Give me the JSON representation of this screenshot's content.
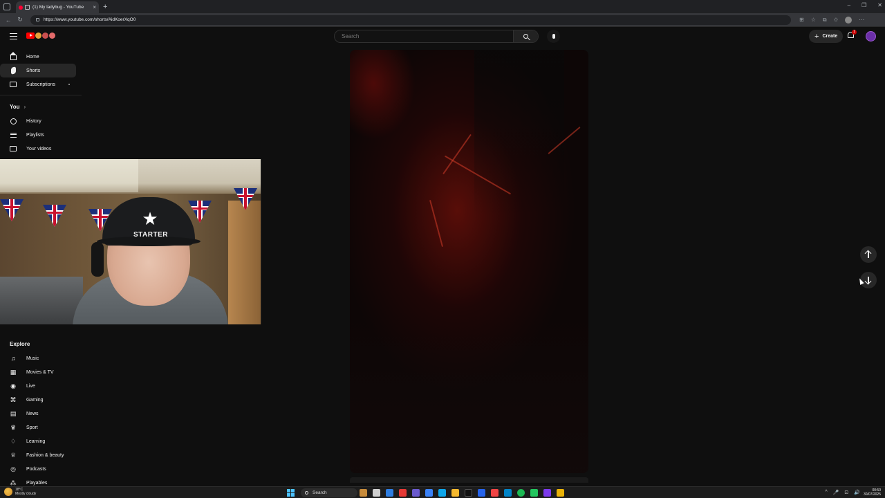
{
  "browser": {
    "tab_title": "(1) My ladybug - YouTube",
    "url": "https://www.youtube.com/shorts/AidKoerXqO0",
    "new_tab_glyph": "+",
    "close_glyph": "×",
    "window_controls": [
      "–",
      "❐",
      "✕"
    ]
  },
  "header": {
    "search_placeholder": "Search",
    "create_label": "Create",
    "create_glyph": "+",
    "notification_count": "1"
  },
  "sidebar": {
    "top_items": [
      {
        "label": "Home",
        "icon": "home-icon"
      },
      {
        "label": "Shorts",
        "icon": "shorts-icon",
        "active": true
      },
      {
        "label": "Subscriptions",
        "icon": "subscriptions-icon"
      }
    ],
    "you_section": {
      "title": "You",
      "chevron": "›",
      "items": [
        {
          "label": "History",
          "icon": "history-icon"
        },
        {
          "label": "Playlists",
          "icon": "playlists-icon"
        },
        {
          "label": "Your videos",
          "icon": "your-videos-icon"
        }
      ]
    },
    "explore_section": {
      "title": "Explore",
      "items": [
        {
          "label": "Music",
          "icon": "music-icon",
          "glyph": "♫"
        },
        {
          "label": "Movies & TV",
          "icon": "movies-icon",
          "glyph": "▦"
        },
        {
          "label": "Live",
          "icon": "live-icon",
          "glyph": "◉"
        },
        {
          "label": "Gaming",
          "icon": "gaming-icon",
          "glyph": "⌘"
        },
        {
          "label": "News",
          "icon": "news-icon",
          "glyph": "▤"
        },
        {
          "label": "Sport",
          "icon": "sport-icon",
          "glyph": "♛"
        },
        {
          "label": "Learning",
          "icon": "learning-icon",
          "glyph": "♢"
        },
        {
          "label": "Fashion & beauty",
          "icon": "fashion-icon",
          "glyph": "♕"
        },
        {
          "label": "Podcasts",
          "icon": "podcasts-icon",
          "glyph": "◎"
        },
        {
          "label": "Playables",
          "icon": "playables-icon",
          "glyph": "⁂"
        }
      ]
    }
  },
  "webcam": {
    "cap_logo": "★",
    "cap_text": "STARTER"
  },
  "player": {
    "up_label": "Previous short",
    "down_label": "Next short"
  },
  "taskbar": {
    "weather_temp": "18°C",
    "weather_desc": "Mostly cloudy",
    "search_label": "Search",
    "time": "00:50",
    "date": "30/07/2025",
    "tray_glyphs": [
      "^",
      "🎤",
      "⊡",
      "🔊"
    ]
  },
  "colors": {
    "background": "#0f0f0f",
    "youtube_red": "#ff0000",
    "active_item": "#272727"
  }
}
